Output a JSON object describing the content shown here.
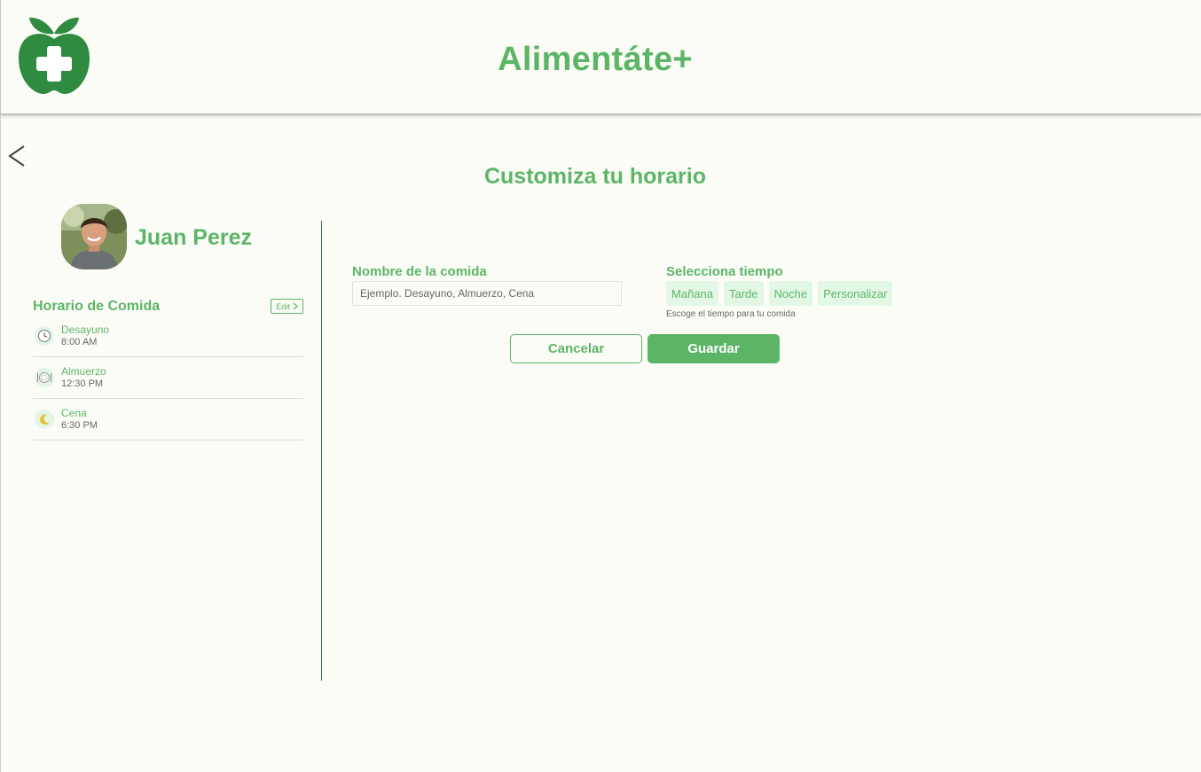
{
  "theme": {
    "accent": "#5cb566",
    "background": "#fcfcf7",
    "chip_bg": "#e3f7e5",
    "divider": "#2f7a4a"
  },
  "header": {
    "app_title": "Alimentáte+",
    "logo_icon": "apple-plus-logo"
  },
  "nav": {
    "back_icon": "chevron-left-icon"
  },
  "page": {
    "title": "Customiza tu horario"
  },
  "user": {
    "name": "Juan Perez",
    "avatar_icon": "user-photo"
  },
  "schedule": {
    "title": "Horario de Comida",
    "edit_label": "Edit",
    "meals": [
      {
        "name": "Desayuno",
        "time": "8:00 AM",
        "icon": "clock-icon"
      },
      {
        "name": "Almuerzo",
        "time": "12:30 PM",
        "icon": "plate-icon"
      },
      {
        "name": "Cena",
        "time": "6:30 PM",
        "icon": "moon-icon"
      }
    ]
  },
  "form": {
    "name_label": "Nombre de la comida",
    "name_placeholder": "Ejemplo. Desayuno, Almuerzo, Cena",
    "time_label": "Selecciona tiempo",
    "time_options": [
      "Mañana",
      "Tarde",
      "Noche",
      "Personalizar"
    ],
    "time_helper": "Escoge el tiempo para tu comida",
    "cancel_label": "Cancelar",
    "save_label": "Guardar"
  }
}
